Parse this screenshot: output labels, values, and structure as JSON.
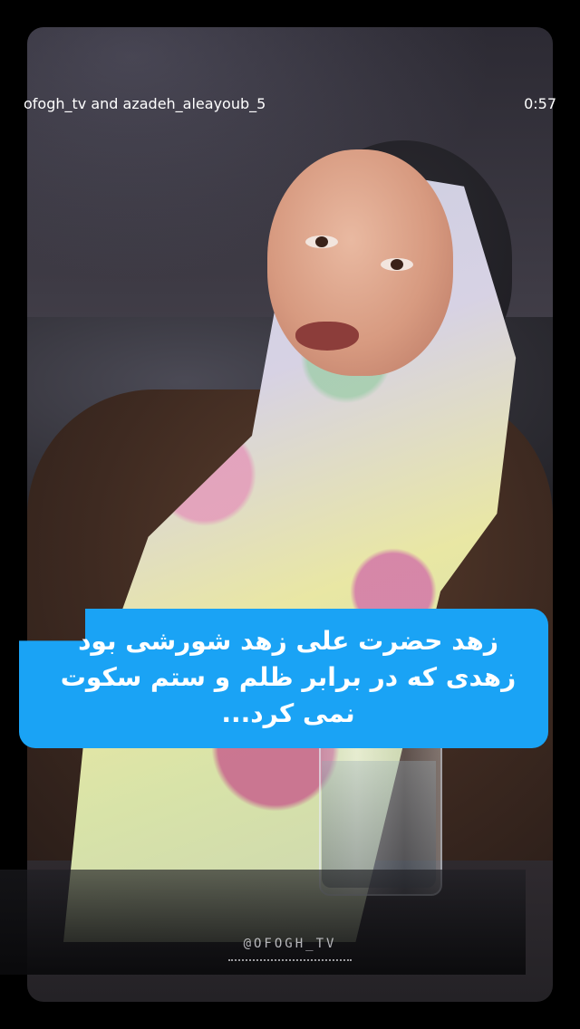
{
  "story": {
    "account_names": "ofogh_tv and azadeh_aleayoub_5",
    "elapsed_time": "0:57"
  },
  "caption": {
    "line1": "زهد حضرت علی زهد شورشی بود",
    "line2": "زهدی که در برابر ظلم و ستم سکوت نمی کرد...",
    "background_color": "#1aa3f5",
    "text_color": "#ffffff"
  },
  "watermark": {
    "text": "@OFOGH_TV"
  }
}
